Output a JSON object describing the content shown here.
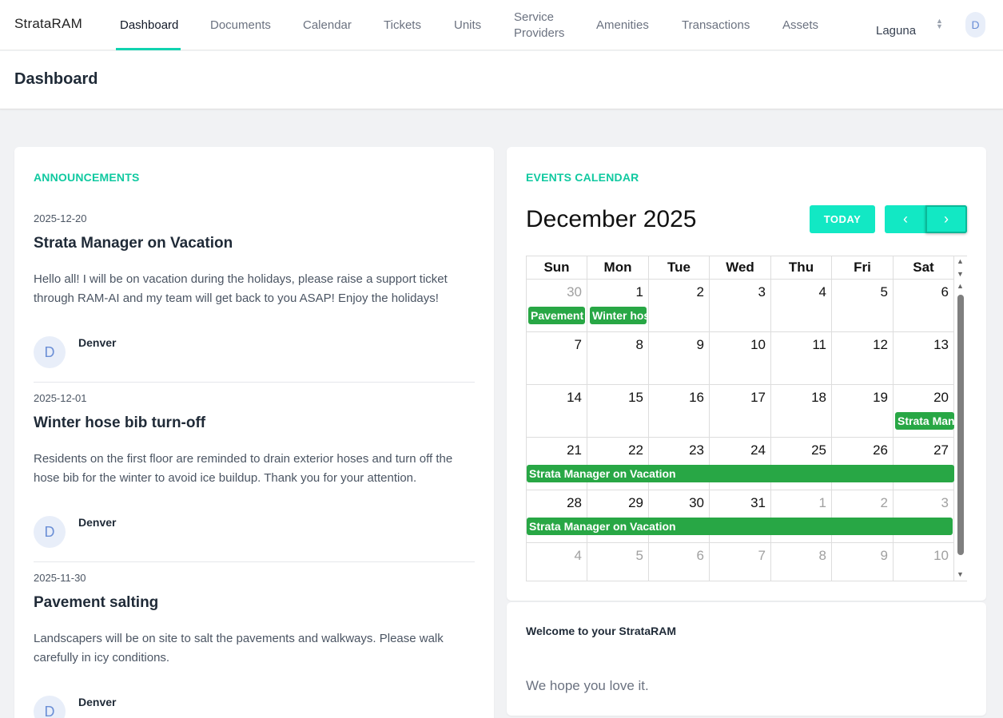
{
  "app": {
    "brand": "StrataRAM"
  },
  "nav": {
    "items": [
      {
        "label": "Dashboard"
      },
      {
        "label": "Documents"
      },
      {
        "label": "Calendar"
      },
      {
        "label": "Tickets"
      },
      {
        "label": "Units"
      },
      {
        "label": "Service",
        "label2": "Providers"
      },
      {
        "label": "Amenities"
      },
      {
        "label": "Transactions"
      },
      {
        "label": "Assets"
      }
    ],
    "building": "Laguna",
    "user_initial": "D"
  },
  "header": {
    "title": "Dashboard"
  },
  "announcements": {
    "title": "ANNOUNCEMENTS",
    "items": [
      {
        "date": "2025-12-20",
        "title": "Strata Manager on Vacation",
        "body": "Hello all! I will be on vacation during the holidays, please raise a support ticket through RAM-AI and my team will get back to you ASAP! Enjoy the holidays!",
        "initial": "D",
        "author": "Denver"
      },
      {
        "date": "2025-12-01",
        "title": "Winter hose bib turn-off",
        "body": "Residents on the first floor are reminded to drain exterior hoses and turn off the hose bib for the winter to avoid ice buildup. Thank you for your attention.",
        "initial": "D",
        "author": "Denver"
      },
      {
        "date": "2025-11-30",
        "title": "Pavement salting",
        "body": "Landscapers will be on site to salt the pavements and walkways. Please walk carefully in icy conditions.",
        "initial": "D",
        "author": "Denver"
      }
    ]
  },
  "calendar": {
    "section_title": "EVENTS CALENDAR",
    "month_title": "December 2025",
    "today_label": "TODAY",
    "prev_glyph": "‹",
    "next_glyph": "›",
    "days_of_week": [
      "Sun",
      "Mon",
      "Tue",
      "Wed",
      "Thu",
      "Fri",
      "Sat"
    ],
    "weeks": [
      [
        "30",
        "1",
        "2",
        "3",
        "4",
        "5",
        "6"
      ],
      [
        "7",
        "8",
        "9",
        "10",
        "11",
        "12",
        "13"
      ],
      [
        "14",
        "15",
        "16",
        "17",
        "18",
        "19",
        "20"
      ],
      [
        "21",
        "22",
        "23",
        "24",
        "25",
        "26",
        "27"
      ],
      [
        "28",
        "29",
        "30",
        "31",
        "1",
        "2",
        "3"
      ],
      [
        "4",
        "5",
        "6",
        "7",
        "8",
        "9",
        "10"
      ]
    ],
    "events": {
      "pavement": "Pavement",
      "winter": "Winter hos",
      "strata_short": "Strata Mana",
      "strata_full_1": "Strata Manager on Vacation",
      "strata_full_2": "Strata Manager on Vacation"
    },
    "event_color": "#28a745",
    "accent_color": "#12e8c4"
  },
  "welcome": {
    "title": "Welcome to your StrataRAM",
    "body": "We hope you love it."
  }
}
